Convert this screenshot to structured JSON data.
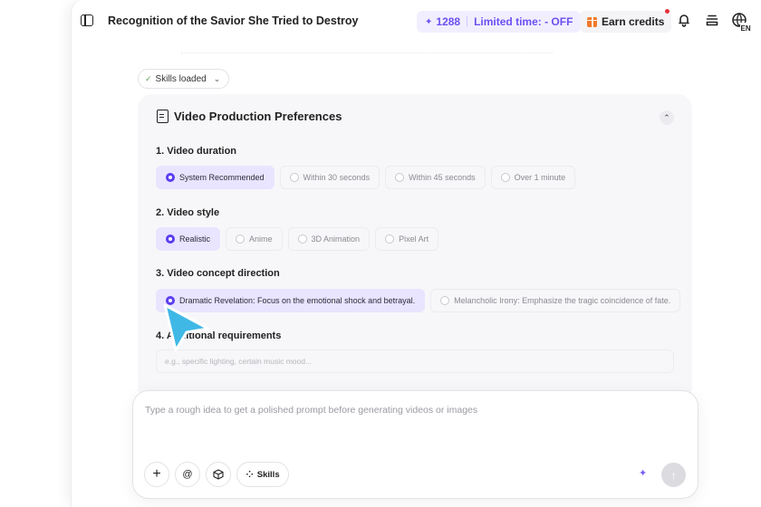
{
  "header": {
    "title": "Recognition of the Savior She Tried to Destroy",
    "credits_count": "1288",
    "promo_text": "Limited time: - OFF",
    "earn_label": "Earn credits",
    "language_badge": "EN"
  },
  "skills_status": "Skills loaded",
  "preferences": {
    "title": "Video Production Preferences",
    "questions": [
      {
        "label": "1. Video duration",
        "options": [
          "System Recommended",
          "Within 30 seconds",
          "Within 45 seconds",
          "Over 1 minute"
        ],
        "selected": "System Recommended"
      },
      {
        "label": "2. Video style",
        "options": [
          "Realistic",
          "Anime",
          "3D Animation",
          "Pixel Art"
        ],
        "selected": "Realistic"
      },
      {
        "label": "3. Video concept direction",
        "options": [
          "Dramatic Revelation: Focus on the emotional shock and betrayal.",
          "Melancholic Irony: Emphasize the tragic coincidence of fate."
        ],
        "selected": "Dramatic Revelation: Focus on the emotional shock and betrayal."
      },
      {
        "label": "4. Additional requirements",
        "placeholder": "e.g., specific lighting, certain music mood..."
      }
    ]
  },
  "prompt": {
    "placeholder": "Type a rough idea to get a polished prompt before generating videos or images",
    "skills_label": "Skills"
  },
  "colors": {
    "accent": "#5a3df0",
    "selected_bg": "#e9e4ff",
    "pointer": "#3fb8e6",
    "promo_text": "#6d4ff2"
  },
  "icons": [
    "sidebar-toggle-icon",
    "bell-icon",
    "layers-icon",
    "globe-language-icon",
    "document-icon",
    "chevron-up-icon",
    "plus-icon",
    "at-icon",
    "cube-icon",
    "grid-icon",
    "sparkle-icon",
    "arrow-up-icon",
    "cursor-pointer-icon"
  ]
}
